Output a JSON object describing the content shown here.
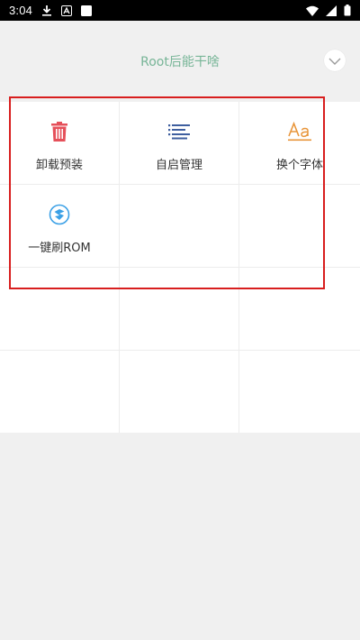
{
  "status_bar": {
    "time": "3:04",
    "left_icons": [
      "download-icon",
      "notification-a-icon",
      "square-icon"
    ],
    "right_icons": [
      "wifi-icon",
      "signal-icon",
      "battery-icon"
    ]
  },
  "header": {
    "title": "Root后能干啥",
    "dropdown_icon": "chevron-down-icon"
  },
  "grid": {
    "items": [
      {
        "label": "卸载预装",
        "icon": "trash-icon",
        "color": "#e5505a"
      },
      {
        "label": "自启管理",
        "icon": "list-icon",
        "color": "#3f5f9f"
      },
      {
        "label": "换个字体",
        "icon": "font-aa-icon",
        "color": "#e8953a"
      },
      {
        "label": "一键刷ROM",
        "icon": "rom-shield-icon",
        "color": "#3aa0e6"
      }
    ]
  },
  "colors": {
    "title_green": "#77b597",
    "highlight_red": "#d81e1e",
    "background": "#f0f0f0"
  }
}
